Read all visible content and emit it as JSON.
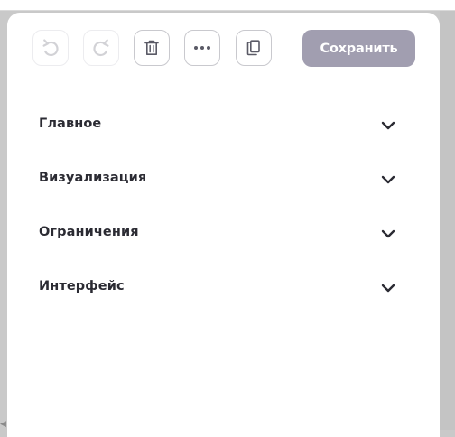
{
  "toolbar": {
    "buttons": [
      {
        "name": "undo",
        "icon": "undo-icon",
        "enabled": false
      },
      {
        "name": "redo",
        "icon": "redo-icon",
        "enabled": false
      },
      {
        "name": "delete",
        "icon": "trash-icon",
        "enabled": true
      },
      {
        "name": "more",
        "icon": "more-horizontal-icon",
        "enabled": true
      },
      {
        "name": "copy",
        "icon": "copy-icon",
        "enabled": true
      }
    ],
    "save_label": "Сохранить"
  },
  "sections": [
    {
      "label": "Главное",
      "icon": "chevron-down-icon",
      "expanded": false
    },
    {
      "label": "Визуализация",
      "icon": "chevron-down-icon",
      "expanded": false
    },
    {
      "label": "Ограничения",
      "icon": "chevron-down-icon",
      "expanded": false
    },
    {
      "label": "Интерфейс",
      "icon": "chevron-down-icon",
      "expanded": false
    }
  ],
  "colors": {
    "save_button_bg": "#a19eb0",
    "text": "#2b2b33",
    "icon_enabled": "#5a5a66",
    "icon_disabled": "#d2d2d6"
  }
}
